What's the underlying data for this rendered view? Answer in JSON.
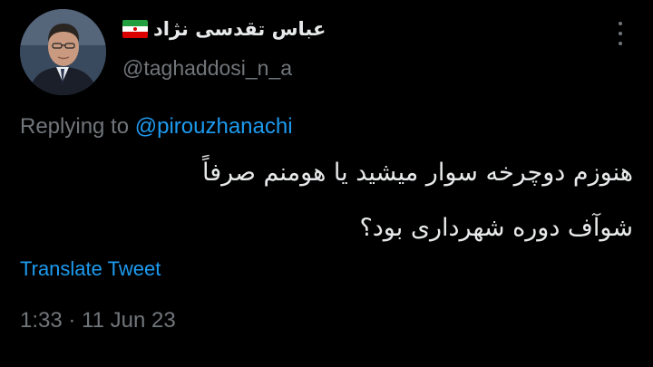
{
  "author": {
    "display_name": "عباس تقدسی نژاد",
    "flag_icon": "iran-flag-icon",
    "handle": "@taghaddosi_n_a",
    "avatar_icon": "avatar-photo"
  },
  "reply": {
    "prefix": "Replying to ",
    "mention": "@pirouzhanachi"
  },
  "tweet": {
    "line1": "هنوزم دوچرخه سوار میشید یا هومنم صرفاً",
    "line2": "شوآف دوره شهرداری بود؟"
  },
  "translate_label": "Translate Tweet",
  "timestamp": {
    "time": "1:33",
    "separator": " · ",
    "date": "11 Jun 23"
  },
  "colors": {
    "background": "#000000",
    "primary_text": "#e7e9ea",
    "secondary_text": "#71767b",
    "link": "#1d9bf0"
  },
  "menu_icon": "more-options-icon"
}
